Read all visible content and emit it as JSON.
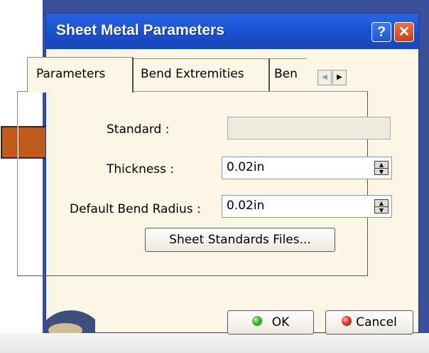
{
  "dialog": {
    "title": "Sheet Metal Parameters",
    "help_glyph": "?",
    "close_glyph": "✕"
  },
  "tabs": [
    {
      "label": "Parameters",
      "active": true
    },
    {
      "label": "Bend Extremities",
      "active": false
    },
    {
      "label": "Ben",
      "active": false
    }
  ],
  "tab_scroll": {
    "left_glyph": "◀",
    "right_glyph": "▶"
  },
  "form": {
    "standard_label": "Standard :",
    "standard_value": "",
    "thickness_label": "Thickness :",
    "thickness_value": "0.02in",
    "bend_radius_label": "Default Bend Radius :",
    "bend_radius_value": "0.02in",
    "spin_up": "▲",
    "spin_down": "▼"
  },
  "buttons": {
    "standards_files": "Sheet Standards Files...",
    "ok": "OK",
    "cancel": "Cancel"
  },
  "colors": {
    "arrow": "#c05a1c",
    "titlebar": "#1d55d4",
    "dialog_bg": "#fbf6e6"
  }
}
